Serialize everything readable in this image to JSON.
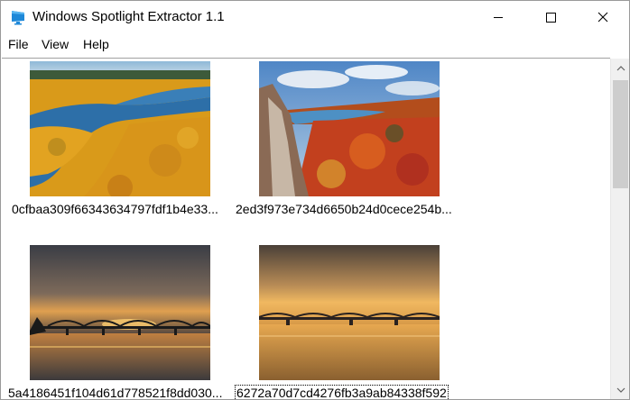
{
  "window": {
    "title": "Windows Spotlight Extractor 1.1",
    "icon": "monitor-icon"
  },
  "menu": {
    "file": "File",
    "view": "View",
    "help": "Help"
  },
  "thumbnails": [
    {
      "name": "0cfbaa309f66343634797fdf1b4e33...",
      "image": "autumn-river-aerial",
      "selected": false
    },
    {
      "name": "2ed3f973e734d6650b24d0cece254b...",
      "image": "autumn-lake-cliffs",
      "selected": false
    },
    {
      "name": "5a4186451f104d61d778521f8dd030...",
      "image": "bridge-sunset-dark",
      "selected": false
    },
    {
      "name": "6272a70d7cd4276fb3a9ab84338f592",
      "image": "bridge-sunset-golden",
      "selected": true
    }
  ],
  "colors": {
    "accent": "#1e88d8",
    "scroll_track": "#f0f0f0",
    "scroll_thumb": "#cdcdcd"
  }
}
